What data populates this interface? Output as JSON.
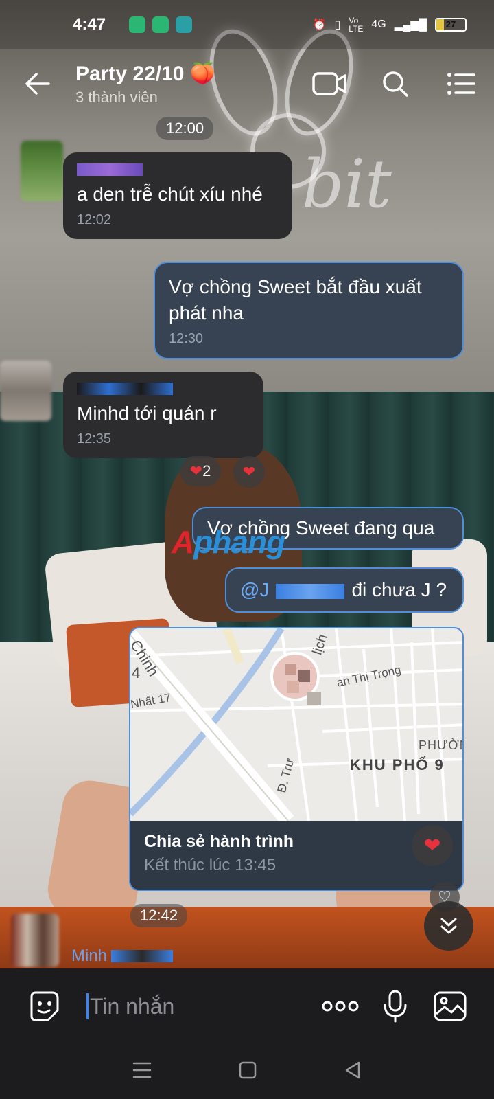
{
  "status": {
    "time": "4:47",
    "network": "4G",
    "battery": "27"
  },
  "header": {
    "title": "Party 22/10 🍑",
    "subtitle": "3 thành viên"
  },
  "wallpaper_text": "bit",
  "messages": [
    {
      "time_chip": "12:00"
    },
    {
      "direction": "in",
      "text": "a den trễ chút xíu nhé",
      "time": "12:02"
    },
    {
      "direction": "out",
      "text": "Vợ chồng Sweet bắt đầu xuất phát nha",
      "time": "12:30"
    },
    {
      "direction": "in",
      "text": "Minhd tới quán r",
      "time": "12:35",
      "reaction_count": "2"
    },
    {
      "direction": "out",
      "text": "Vợ chồng Sweet đang qua"
    },
    {
      "direction": "out",
      "mention": "@J",
      "text": "đi chưa J ?"
    }
  ],
  "map_card": {
    "title": "Chia sẻ hành trình",
    "subtitle": "Kết thúc lúc 13:45",
    "labels": {
      "street1": "Chinh",
      "street1_num": "4",
      "street2": "Nhất 17",
      "street3": "an Thị Trọng",
      "street4": "lịch",
      "ward": "PHƯỜN",
      "quarter": "KHU PHỐ 9",
      "road": "Đ. Trư"
    }
  },
  "time_chip_2": "12:42",
  "sender_partial": "Minh",
  "watermark": "Aphang",
  "input": {
    "placeholder": "Tin nhắn"
  },
  "colors": {
    "accent": "#4f8ed8",
    "heart": "#e5323c",
    "watermark_red": "#e0242b",
    "watermark_blue": "#2b8fd8"
  }
}
